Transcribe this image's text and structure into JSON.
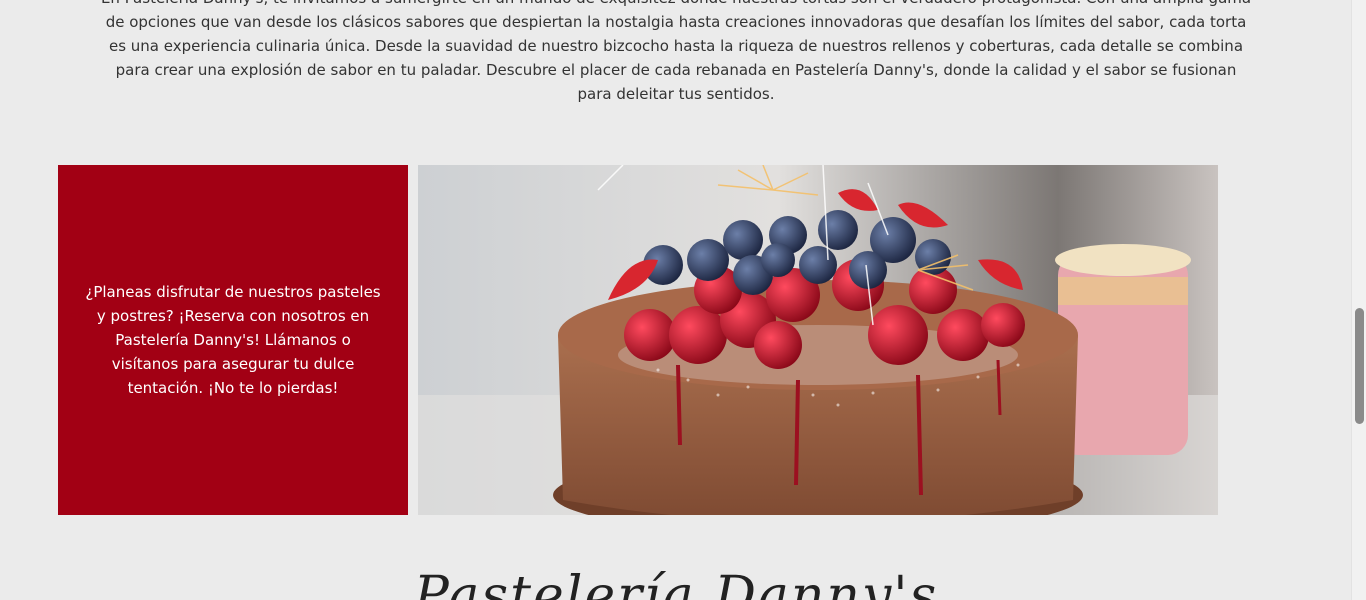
{
  "intro": {
    "text": "En Pastelería Danny's, te invitamos a sumergirte en un mundo de exquisitez donde nuestras tortas son el verdadero protagonista. Con una amplia gama de opciones que van desde los clásicos sabores que despiertan la nostalgia hasta creaciones innovadoras que desafían los límites del sabor, cada torta es una experiencia culinaria única. Desde la suavidad de nuestro bizcocho hasta la riqueza de nuestros rellenos y coberturas, cada detalle se combina para crear una explosión de sabor en tu paladar. Descubre el placer de cada rebanada en Pastelería Danny's, donde la calidad y el sabor se fusionan para deleitar tus sentidos."
  },
  "promo": {
    "text": "¿Planeas disfrutar de nuestros pasteles y postres? ¡Reserva con nosotros en Pastelería Danny's! Llámanos o visítanos para asegurar tu dulce tentación. ¡No te lo pierdas!",
    "background_color": "#a20014"
  },
  "brand": {
    "title": "Pastelería Danny's"
  },
  "scrollbar": {
    "position_fraction": 0.52
  }
}
